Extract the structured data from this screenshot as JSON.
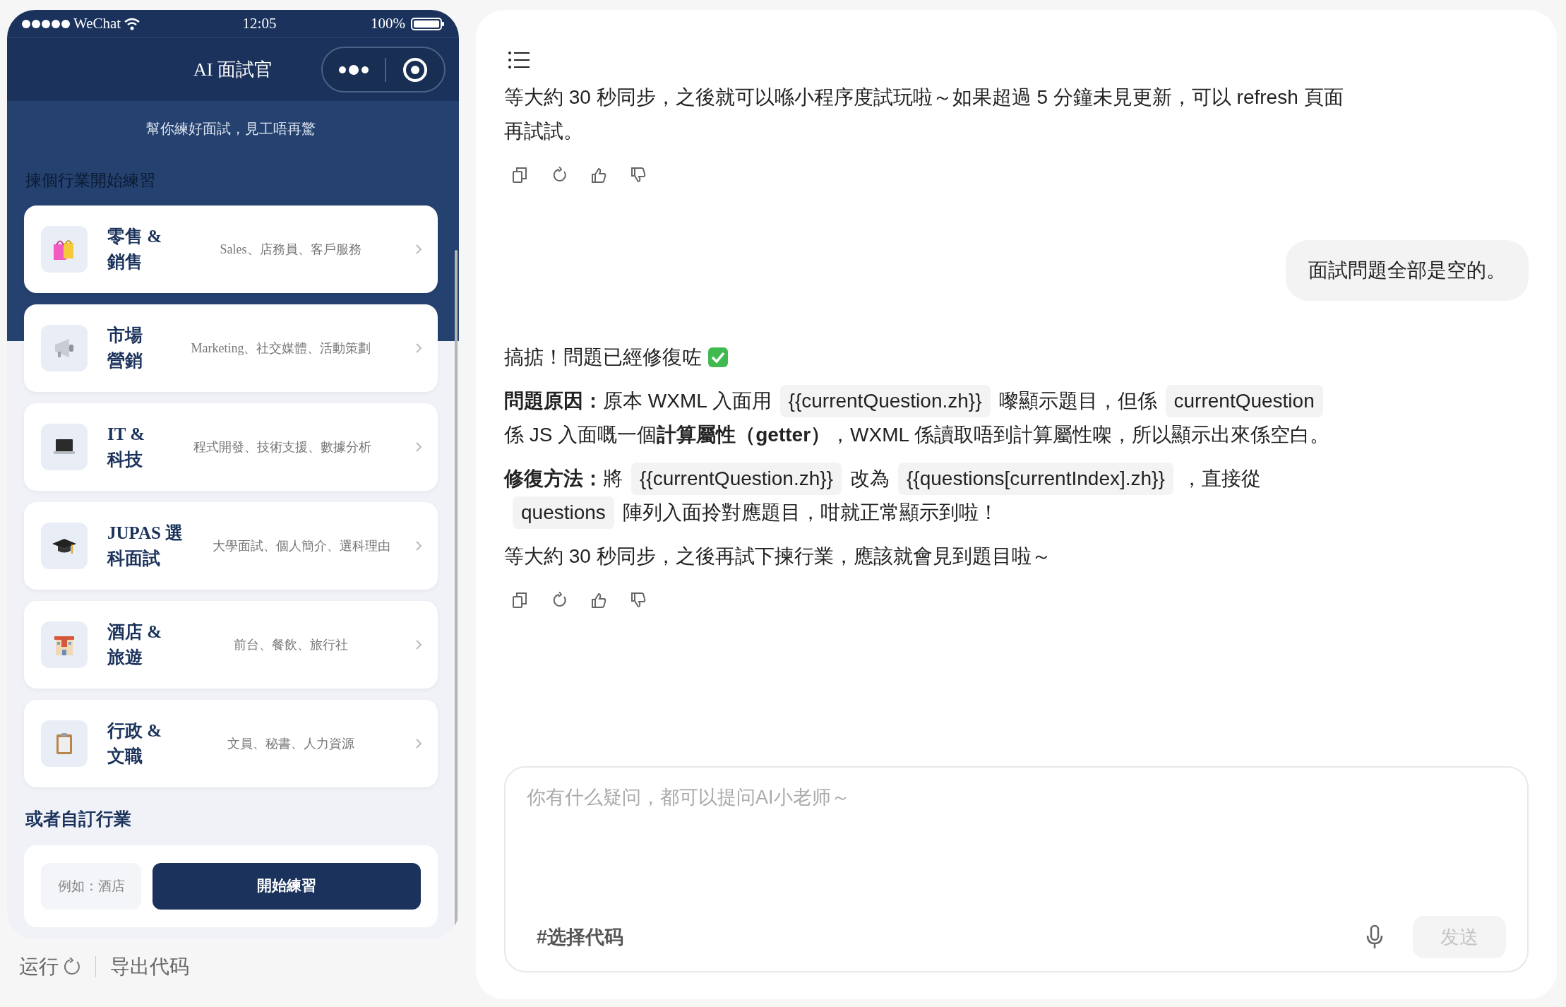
{
  "phone": {
    "status_bar": {
      "carrier": "WeChat",
      "time": "12:05",
      "battery": "100%"
    },
    "nav": {
      "title": "AI 面試官"
    },
    "hero": {
      "subtitle": "幫你練好面試，見工唔再驚",
      "section_label": "揀個行業開始練習"
    },
    "industries": [
      {
        "title_lines": [
          "零售 &",
          "銷售"
        ],
        "description": "Sales、店務員、客戶服務"
      },
      {
        "title_lines": [
          "市場",
          "營銷"
        ],
        "description": "Marketing、社交媒體、活動策劃"
      },
      {
        "title_lines": [
          "IT &",
          "科技"
        ],
        "description": "程式開發、技術支援、數據分析"
      },
      {
        "title_lines": [
          "JUPAS 選",
          "科面試"
        ],
        "description": "大學面試、個人簡介、選科理由"
      },
      {
        "title_lines": [
          "酒店 &",
          "旅遊"
        ],
        "description": "前台、餐飲、旅行社"
      },
      {
        "title_lines": [
          "行政 &",
          "文職"
        ],
        "description": "文員、秘書、人力資源"
      }
    ],
    "custom": {
      "heading": "或者自訂行業",
      "placeholder": "例如：酒店",
      "button": "開始練習"
    }
  },
  "toolbar": {
    "run": "运行",
    "export": "导出代码"
  },
  "chat": {
    "messages": [
      {
        "kind": "assistant",
        "actions": true,
        "paragraphs": [
          [
            {
              "kind": "text",
              "text": "等大約 30 秒同步，之後就可以喺小程序度試玩啦～如果超過 5 分鐘未見更新，可以 refresh 頁面再試試。"
            }
          ]
        ]
      },
      {
        "kind": "user",
        "text": "面試問題全部是空的。"
      },
      {
        "kind": "assistant",
        "actions": true,
        "paragraphs": [
          [
            {
              "kind": "text",
              "text": "搞掂！問題已經修復咗"
            },
            {
              "kind": "check"
            }
          ],
          [
            {
              "kind": "bold",
              "text": "問題原因："
            },
            {
              "kind": "text",
              "text": "原本 WXML 入面用"
            },
            {
              "kind": "code",
              "text": "{{currentQuestion.zh}}"
            },
            {
              "kind": "text",
              "text": "嚟顯示題目，但係"
            },
            {
              "kind": "code",
              "text": "currentQuestion"
            },
            {
              "kind": "text",
              "text": "係 JS 入面嘅一個"
            },
            {
              "kind": "bold",
              "text": "計算屬性（getter）"
            },
            {
              "kind": "text",
              "text": "，WXML 係讀取唔到計算屬性㗎，所以顯示出來係空白。"
            }
          ],
          [
            {
              "kind": "bold",
              "text": "修復方法："
            },
            {
              "kind": "text",
              "text": "將"
            },
            {
              "kind": "code",
              "text": "{{currentQuestion.zh}}"
            },
            {
              "kind": "text",
              "text": "改為"
            },
            {
              "kind": "code",
              "text": "{{questions[currentIndex].zh}}"
            },
            {
              "kind": "text",
              "text": "，直接從"
            },
            {
              "kind": "code",
              "text": "questions"
            },
            {
              "kind": "text",
              "text": "陣列入面拎對應題目，咁就正常顯示到啦！"
            }
          ],
          [
            {
              "kind": "text",
              "text": "等大約 30 秒同步，之後再試下揀行業，應該就會見到題目啦～"
            }
          ]
        ]
      }
    ],
    "input": {
      "placeholder": "你有什么疑问，都可以提问AI小老师～",
      "code_tag": "#选择代码",
      "send": "发送",
      "send_disabled": true
    }
  }
}
